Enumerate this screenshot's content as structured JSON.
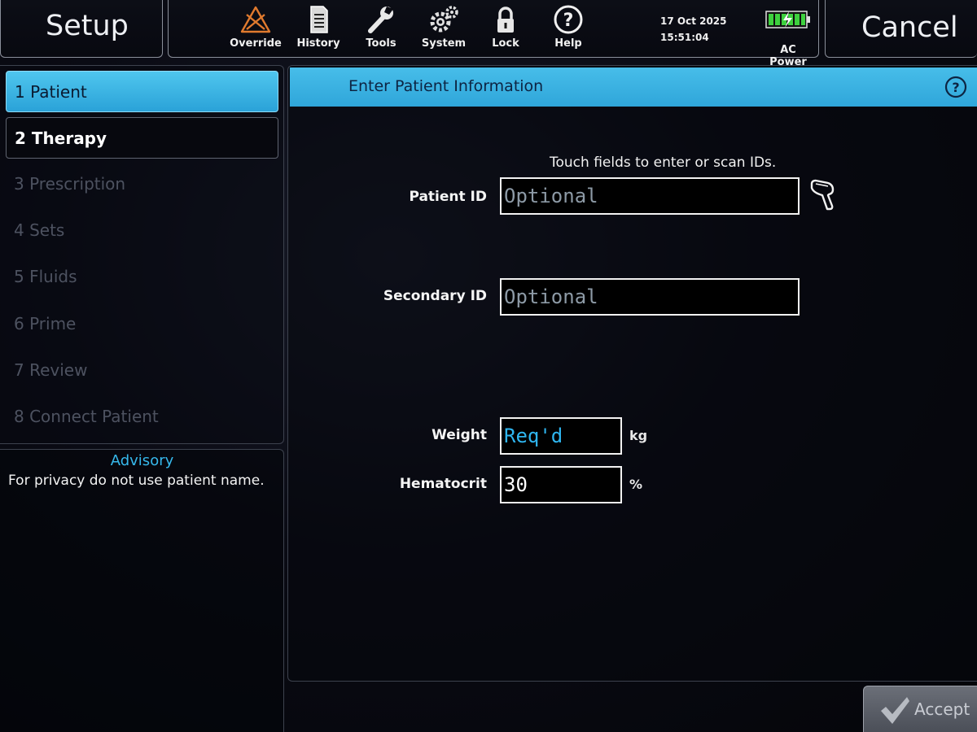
{
  "header": {
    "left_title": "Setup",
    "right_title": "Cancel",
    "tools": [
      {
        "label": "Override",
        "icon": "override-icon"
      },
      {
        "label": "History",
        "icon": "history-icon"
      },
      {
        "label": "Tools",
        "icon": "wrench-icon"
      },
      {
        "label": "System",
        "icon": "gears-icon"
      },
      {
        "label": "Lock",
        "icon": "lock-icon"
      },
      {
        "label": "Help",
        "icon": "help-icon"
      }
    ],
    "date": "17 Oct 2025",
    "time": "15:51:04",
    "power_label": "AC Power",
    "battery_icon": "battery-charging-icon"
  },
  "steps": [
    {
      "label": "1 Patient",
      "state": "active"
    },
    {
      "label": "2 Therapy",
      "state": "next"
    },
    {
      "label": "3 Prescription",
      "state": "disabled"
    },
    {
      "label": "4 Sets",
      "state": "disabled"
    },
    {
      "label": "5 Fluids",
      "state": "disabled"
    },
    {
      "label": "6 Prime",
      "state": "disabled"
    },
    {
      "label": "7 Review",
      "state": "disabled"
    },
    {
      "label": "8 Connect Patient",
      "state": "disabled"
    }
  ],
  "advisory": {
    "title": "Advisory",
    "text": "For privacy do not use patient name."
  },
  "main": {
    "title": "Enter Patient Information",
    "help_icon": "help-circle-icon",
    "instruction": "Touch fields to enter or scan IDs.",
    "fields": {
      "patient_id": {
        "label": "Patient ID",
        "placeholder": "Optional"
      },
      "secondary_id": {
        "label": "Secondary ID",
        "placeholder": "Optional"
      },
      "weight": {
        "label": "Weight",
        "value": "Req'd",
        "unit": "kg"
      },
      "hematocrit": {
        "label": "Hematocrit",
        "value": "30",
        "unit": "%"
      }
    }
  },
  "footer": {
    "accept_label": "Accept"
  },
  "colors": {
    "accent": "#2fa6da",
    "required_text": "#2fb6f0",
    "override_icon": "#e07a2e",
    "battery": "#3ed13e"
  }
}
